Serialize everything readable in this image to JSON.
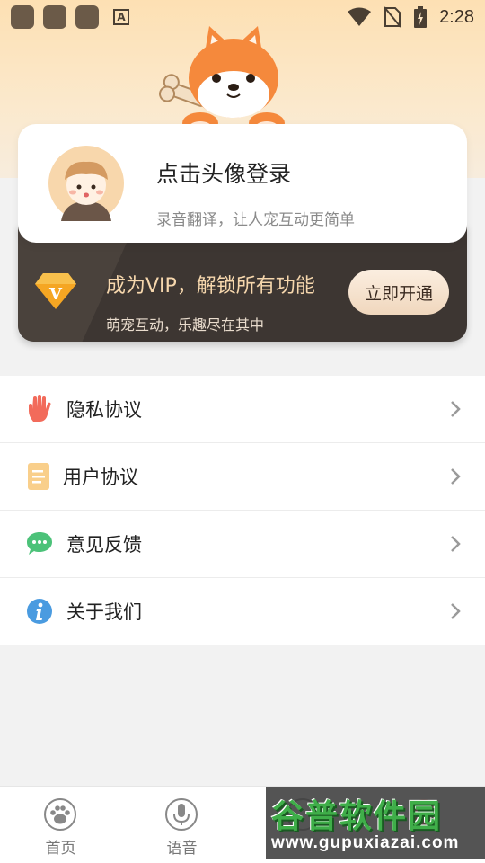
{
  "status_bar": {
    "time": "2:28"
  },
  "profile": {
    "title": "点击头像登录",
    "subtitle": "录音翻译，让人宠互动更简单"
  },
  "vip": {
    "badge_letter": "V",
    "title": "成为VIP，解锁所有功能",
    "subtitle": "萌宠互动，乐趣尽在其中",
    "button": "立即开通"
  },
  "menu": {
    "items": [
      {
        "label": "隐私协议",
        "icon": "hand-icon"
      },
      {
        "label": "用户协议",
        "icon": "document-icon"
      },
      {
        "label": "意见反馈",
        "icon": "chat-bubble-icon"
      },
      {
        "label": "关于我们",
        "icon": "info-icon"
      }
    ]
  },
  "tabs": [
    {
      "label": "首页",
      "icon": "paw-icon"
    },
    {
      "label": "语音",
      "icon": "microphone-icon"
    },
    {
      "label": "",
      "icon": "tab-3-icon"
    },
    {
      "label": "",
      "icon": "tab-4-icon"
    }
  ],
  "watermark": {
    "title": "谷普软件园",
    "url": "www.gupuxiazai.com"
  },
  "colors": {
    "header_bg": "#fde0b3",
    "vip_bg": "#3d3632",
    "vip_text": "#f6d7ad",
    "page_bg": "#f2f2f2"
  }
}
